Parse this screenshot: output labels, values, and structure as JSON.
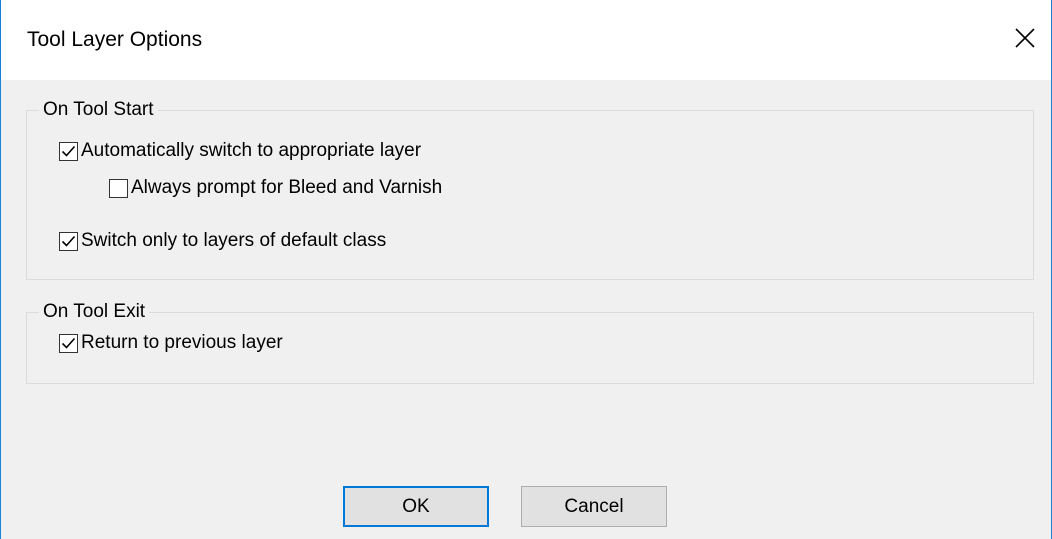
{
  "window": {
    "title": "Tool Layer Options"
  },
  "on_tool_start": {
    "legend": "On Tool Start",
    "options": [
      {
        "label": "Automatically switch to appropriate layer",
        "checked": true
      },
      {
        "label": "Always prompt for Bleed and Varnish",
        "checked": false
      },
      {
        "label": "Switch only to layers of default class",
        "checked": true
      }
    ]
  },
  "on_tool_exit": {
    "legend": "On Tool Exit",
    "options": [
      {
        "label": "Return to previous layer",
        "checked": true
      }
    ]
  },
  "buttons": {
    "ok_label": "OK",
    "cancel_label": "Cancel"
  },
  "colors": {
    "window_border": "#1883d7",
    "client_background": "#f0f0f0",
    "button_default_border": "#0078d7",
    "button_face": "#e1e1e1"
  },
  "icons": {
    "close": "close-icon",
    "check": "checkmark-icon"
  }
}
